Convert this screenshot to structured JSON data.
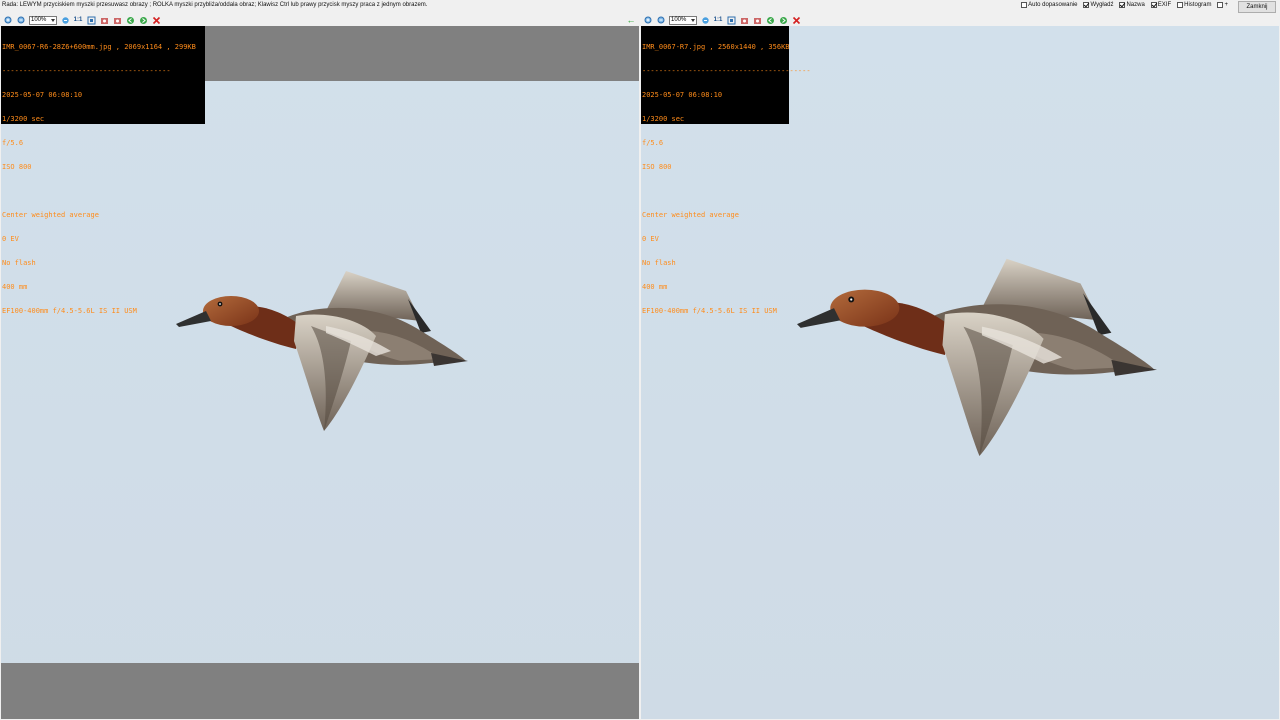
{
  "hint": "Rada: LEWYM przyciskiem myszki przesuwasz obrazy ; ROLKA myszki przybliża/oddala obraz; Klawisz Ctrl lub prawy przycisk myszy praca z jednym obrazem.",
  "options": [
    {
      "label": "Auto dopasowanie",
      "checked": false
    },
    {
      "label": "Wygładź",
      "checked": true
    },
    {
      "label": "Nazwa",
      "checked": true
    },
    {
      "label": "EXIF",
      "checked": true
    },
    {
      "label": "Histogram",
      "checked": false
    },
    {
      "label": "+",
      "checked": false
    }
  ],
  "close_label": "Zamknij",
  "colors": {
    "exif_text": "#ff8c1a",
    "sky": "#d2e0eb",
    "band": "#808080"
  },
  "icons": [
    "zoom-in-icon",
    "zoom-out-icon",
    "fit-icon",
    "one-to-one-icon",
    "full-screen-icon",
    "rotate-left-icon",
    "rotate-right-icon",
    "prev-icon",
    "next-icon",
    "close-icon"
  ],
  "left": {
    "zoom": "100%",
    "one_to_one": "1:1",
    "exif": {
      "filename": "IMR_0067-R6-28Z6+600mm.jpg , 2069x1164 , 299KB",
      "separator": "----------------------------------------",
      "datetime": "2025-05-07 06:08:10",
      "shutter": "1/3200 sec",
      "aperture": "f/5.6",
      "iso": "ISO 800",
      "metering": "Center weighted average",
      "ev": "0 EV",
      "flash": "No flash",
      "focal": "400 mm",
      "lens": "EF100-400mm f/4.5-5.6L IS II USM"
    }
  },
  "right": {
    "zoom": "100%",
    "one_to_one": "1:1",
    "exif": {
      "filename": "IMR_0067-R7.jpg , 2560x1440 , 356KB",
      "separator": "----------------------------------------",
      "datetime": "2025-05-07 06:08:10",
      "shutter": "1/3200 sec",
      "aperture": "f/5.6",
      "iso": "ISO 800",
      "metering": "Center weighted average",
      "ev": "0 EV",
      "flash": "No flash",
      "focal": "400 mm",
      "lens": "EF100-400mm f/4.5-5.6L IS II USM"
    }
  }
}
